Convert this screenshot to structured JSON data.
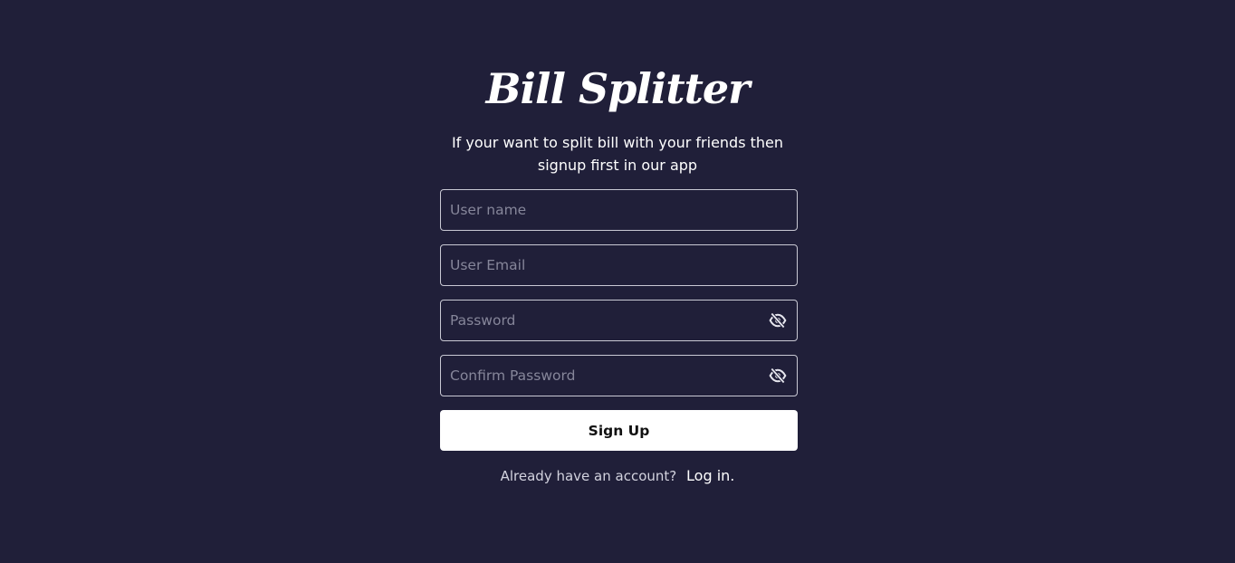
{
  "app": {
    "title": "Bill Splitter",
    "subtitle": "If your want to split bill with your friends then signup first in our app"
  },
  "form": {
    "username_placeholder": "User name",
    "email_placeholder": "User Email",
    "password_placeholder": "Password",
    "confirm_password_placeholder": "Confirm Password",
    "password_toggle_icon": "eye-off-icon",
    "signup_label": "Sign Up"
  },
  "footer": {
    "question": "Already have an account?",
    "login_link": "Log in."
  },
  "colors": {
    "background": "#201f39",
    "field_border": "#c9c9d4",
    "button_bg": "#ffffff",
    "button_text": "#111111"
  }
}
